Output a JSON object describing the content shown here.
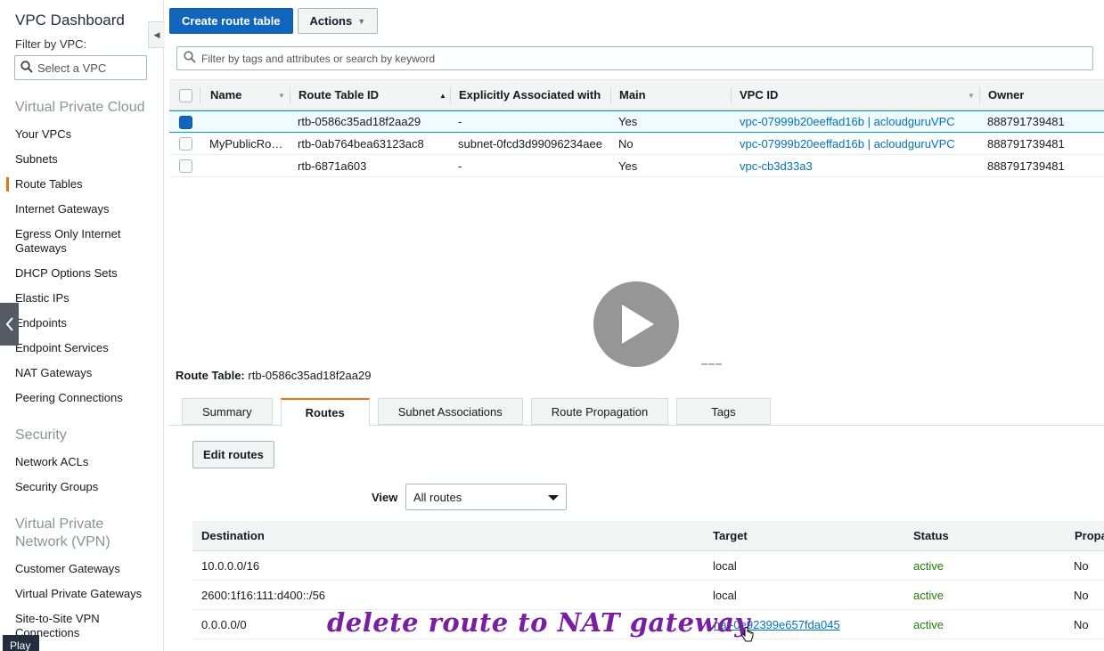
{
  "sidebar": {
    "title": "VPC Dashboard",
    "filter_label": "Filter by VPC:",
    "vpc_select_placeholder": "Select a VPC",
    "sections": [
      {
        "label": "Virtual Private Cloud"
      },
      {
        "label": "Security"
      },
      {
        "label_line1": "Virtual Private",
        "label_line2": "Network (VPN)"
      }
    ],
    "vpc_items": [
      "Your VPCs",
      "Subnets",
      "Route Tables",
      "Internet Gateways",
      "Egress Only Internet Gateways",
      "DHCP Options Sets",
      "Elastic IPs",
      "Endpoints",
      "Endpoint Services",
      "NAT Gateways",
      "Peering Connections"
    ],
    "security_items": [
      "Network ACLs",
      "Security Groups"
    ],
    "vpn_items": [
      "Customer Gateways",
      "Virtual Private Gateways",
      "Site-to-Site VPN Connections"
    ],
    "play_tag": "Play"
  },
  "toolbar": {
    "create_label": "Create route table",
    "actions_label": "Actions"
  },
  "search": {
    "placeholder": "Filter by tags and attributes or search by keyword"
  },
  "route_tables": {
    "columns": [
      "Name",
      "Route Table ID",
      "Explicitly Associated with",
      "Main",
      "VPC ID",
      "Owner"
    ],
    "rows": [
      {
        "name": "",
        "id": "rtb-0586c35ad18f2aa29",
        "assoc": "-",
        "main": "Yes",
        "vpc": "vpc-07999b20eeffad16b | acloudguruVPC",
        "owner": "888791739481",
        "selected": true
      },
      {
        "name": "MyPublicRo…",
        "id": "rtb-0ab764bea63123ac8",
        "assoc": "subnet-0fcd3d99096234aee",
        "main": "No",
        "vpc": "vpc-07999b20eeffad16b | acloudguruVPC",
        "owner": "888791739481",
        "selected": false
      },
      {
        "name": "",
        "id": "rtb-6871a603",
        "assoc": "-",
        "main": "Yes",
        "vpc": "vpc-cb3d33a3",
        "owner": "888791739481",
        "selected": false
      }
    ]
  },
  "detail": {
    "title_label": "Route Table:",
    "title_value": "rtb-0586c35ad18f2aa29",
    "tabs": [
      "Summary",
      "Routes",
      "Subnet Associations",
      "Route Propagation",
      "Tags"
    ],
    "active_tab": "Routes",
    "edit_routes_label": "Edit routes",
    "view_label": "View",
    "view_selected": "All routes",
    "routes_columns": [
      "Destination",
      "Target",
      "Status",
      "Propa"
    ],
    "routes": [
      {
        "destination": "10.0.0.0/16",
        "target": "local",
        "status": "active",
        "propagated": "No"
      },
      {
        "destination": "2600:1f16:111:d400::/56",
        "target": "local",
        "status": "active",
        "propagated": "No"
      },
      {
        "destination": "0.0.0.0/0",
        "target": "nat-0e92399e657fda045",
        "status": "active",
        "propagated": "No"
      }
    ]
  },
  "annotation": "delete route to NAT gateway",
  "colors": {
    "primary": "#1166bb",
    "link": "#0073bb",
    "active_status": "#1d8102",
    "tab_accent": "#ec7211",
    "annotation": "#7a1fa2"
  }
}
